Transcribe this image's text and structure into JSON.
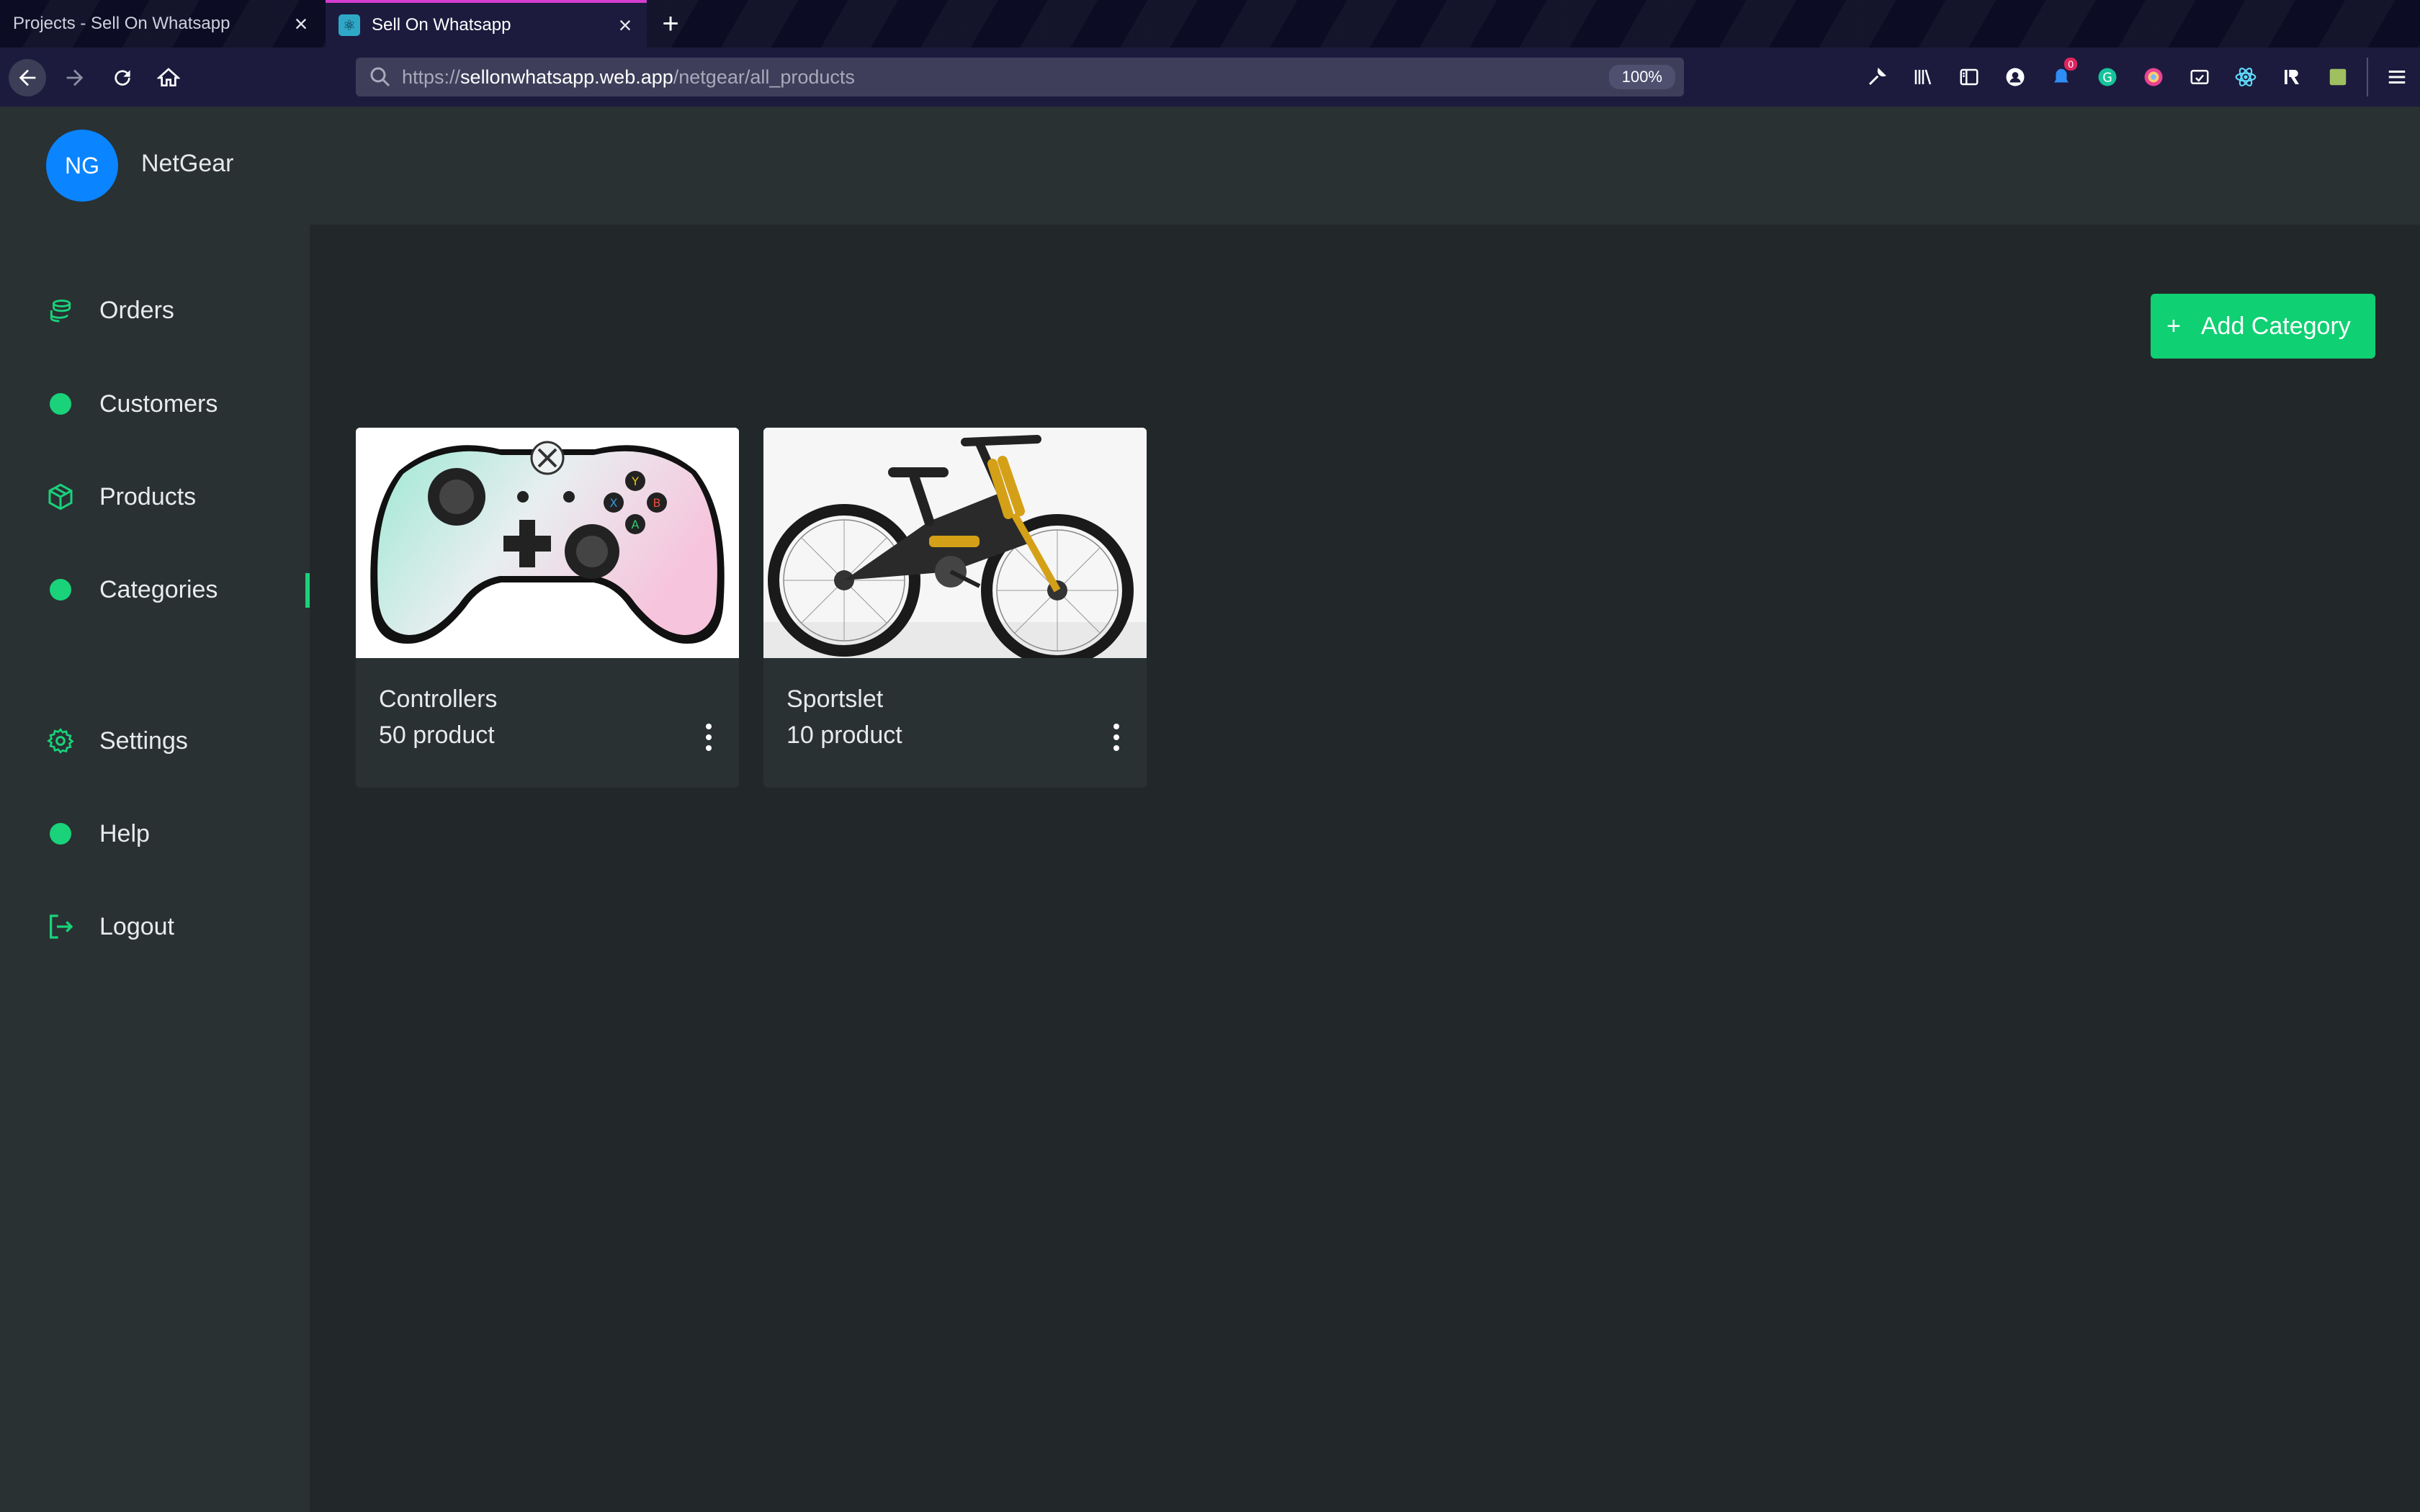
{
  "browser": {
    "tabs": [
      {
        "title": "Projects - Sell On Whatsapp",
        "active": false
      },
      {
        "title": "Sell On Whatsapp",
        "active": true
      }
    ],
    "url_prefix": "https://",
    "url_host": "sellonwhatsapp.web.app",
    "url_path": "/netgear/all_products",
    "zoom": "100%",
    "notification_count": "0",
    "accent_color": "#d33dd0"
  },
  "header": {
    "avatar_initials": "NG",
    "business_name": "NetGear",
    "avatar_color": "#0a84ff"
  },
  "sidebar": {
    "items": [
      {
        "label": "Orders",
        "icon": "coins-icon"
      },
      {
        "label": "Customers",
        "icon": "dot-icon"
      },
      {
        "label": "Products",
        "icon": "box-icon"
      },
      {
        "label": "Categories",
        "icon": "dot-icon",
        "active": true
      },
      {
        "label": "Settings",
        "icon": "gear-icon"
      },
      {
        "label": "Help",
        "icon": "dot-icon"
      },
      {
        "label": "Logout",
        "icon": "logout-icon"
      }
    ],
    "accent_color": "#19d27a"
  },
  "main": {
    "add_button": {
      "plus": "+",
      "label": "Add Category"
    },
    "categories": [
      {
        "name": "Controllers",
        "count": "50 product",
        "image": "game-controller-image"
      },
      {
        "name": "Sportslet",
        "count": "10 product",
        "image": "mountain-bike-image"
      }
    ]
  }
}
